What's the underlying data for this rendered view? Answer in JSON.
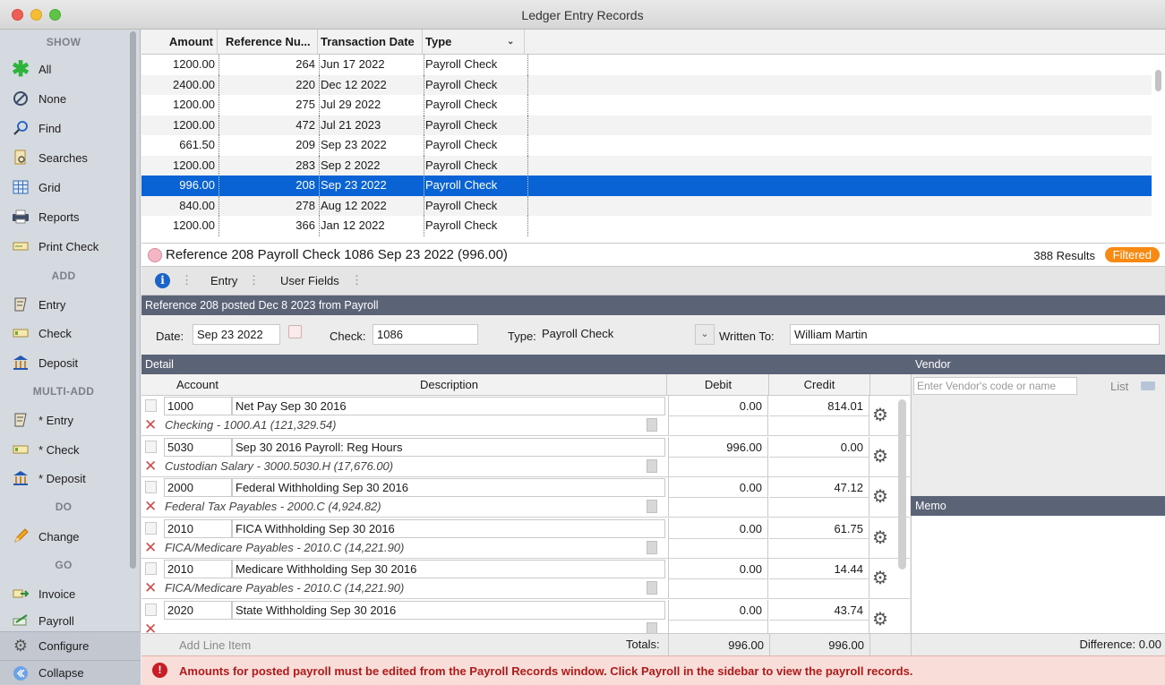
{
  "window": {
    "title": "Ledger Entry Records"
  },
  "sidebar": {
    "sections": {
      "show": "SHOW",
      "add": "ADD",
      "multi_add": "MULTI-ADD",
      "do": "DO",
      "go": "GO"
    },
    "show_items": [
      {
        "label": "All",
        "icon": "asterisk-icon"
      },
      {
        "label": "None",
        "icon": "no-symbol-icon"
      },
      {
        "label": "Find",
        "icon": "magnifier-icon"
      },
      {
        "label": "Searches",
        "icon": "saved-searches-icon"
      },
      {
        "label": "Grid",
        "icon": "grid-icon"
      },
      {
        "label": "Reports",
        "icon": "printer-icon"
      },
      {
        "label": "Print Check",
        "icon": "print-check-icon"
      }
    ],
    "add_items": [
      {
        "label": "Entry",
        "icon": "ledger-icon"
      },
      {
        "label": "Check",
        "icon": "check-icon"
      },
      {
        "label": "Deposit",
        "icon": "bank-icon"
      }
    ],
    "multi_add_items": [
      {
        "label": "* Entry",
        "icon": "ledger-icon"
      },
      {
        "label": "* Check",
        "icon": "check-icon"
      },
      {
        "label": "* Deposit",
        "icon": "bank-icon"
      }
    ],
    "do_items": [
      {
        "label": "Change",
        "icon": "pencil-icon"
      }
    ],
    "go_items": [
      {
        "label": "Invoice",
        "icon": "invoice-icon"
      },
      {
        "label": "Payroll",
        "icon": "payroll-icon"
      }
    ],
    "configure": "Configure",
    "collapse": "Collapse"
  },
  "table": {
    "columns": [
      "Amount",
      "Reference Nu...",
      "Transaction Date",
      "Type"
    ],
    "rows": [
      {
        "amount": "1200.00",
        "ref": "264",
        "date": "Jun 17 2022",
        "type": "Payroll Check"
      },
      {
        "amount": "2400.00",
        "ref": "220",
        "date": "Dec 12 2022",
        "type": "Payroll Check"
      },
      {
        "amount": "1200.00",
        "ref": "275",
        "date": "Jul 29 2022",
        "type": "Payroll Check"
      },
      {
        "amount": "1200.00",
        "ref": "472",
        "date": "Jul 21 2023",
        "type": "Payroll Check"
      },
      {
        "amount": "661.50",
        "ref": "209",
        "date": "Sep 23 2022",
        "type": "Payroll Check"
      },
      {
        "amount": "1200.00",
        "ref": "283",
        "date": "Sep 2 2022",
        "type": "Payroll Check"
      },
      {
        "amount": "996.00",
        "ref": "208",
        "date": "Sep 23 2022",
        "type": "Payroll Check",
        "selected": true
      },
      {
        "amount": "840.00",
        "ref": "278",
        "date": "Aug 12 2022",
        "type": "Payroll Check"
      },
      {
        "amount": "1200.00",
        "ref": "366",
        "date": "Jan 12 2022",
        "type": "Payroll Check"
      }
    ]
  },
  "record": {
    "heading": "Reference 208 Payroll Check 1086 Sep 23 2022 (996.00)",
    "results": "388 Results",
    "filtered": "Filtered",
    "tabs": [
      "Entry",
      "User Fields"
    ],
    "posted_note": "Reference 208 posted Dec 8 2023 from Payroll",
    "date_label": "Date:",
    "date_value": "Sep 23 2022",
    "check_label": "Check:",
    "check_value": "1086",
    "type_label": "Type:",
    "type_value": "Payroll Check",
    "written_to_label": "Written To:",
    "written_to_value": "William Martin"
  },
  "detail": {
    "title": "Detail",
    "headers": {
      "account": "Account",
      "description": "Description",
      "debit": "Debit",
      "credit": "Credit"
    },
    "lines": [
      {
        "account": "1000",
        "description": "Net Pay Sep 30 2016",
        "account_name": "Checking - 1000.A1 (121,329.54)",
        "debit": "0.00",
        "credit": "814.01"
      },
      {
        "account": "5030",
        "description": "Sep 30 2016 Payroll: Reg Hours",
        "account_name": "Custodian Salary - 3000.5030.H (17,676.00)",
        "debit": "996.00",
        "credit": "0.00"
      },
      {
        "account": "2000",
        "description": "Federal Withholding Sep 30 2016",
        "account_name": "Federal Tax Payables - 2000.C (4,924.82)",
        "debit": "0.00",
        "credit": "47.12"
      },
      {
        "account": "2010",
        "description": "FICA Withholding Sep 30 2016",
        "account_name": "FICA/Medicare Payables - 2010.C (14,221.90)",
        "debit": "0.00",
        "credit": "61.75"
      },
      {
        "account": "2010",
        "description": "Medicare Withholding Sep 30 2016",
        "account_name": "FICA/Medicare Payables - 2010.C (14,221.90)",
        "debit": "0.00",
        "credit": "14.44"
      },
      {
        "account": "2020",
        "description": "State Withholding Sep 30 2016",
        "account_name": "",
        "debit": "0.00",
        "credit": "43.74"
      }
    ],
    "add_line": "Add Line Item",
    "totals_label": "Totals:",
    "total_debit": "996.00",
    "total_credit": "996.00",
    "difference": "Difference: 0.00"
  },
  "vendor": {
    "title": "Vendor",
    "placeholder": "Enter Vendor's code or name",
    "list_label": "List",
    "memo_title": "Memo"
  },
  "warning": "Amounts for posted payroll must be edited from the Payroll Records window. Click Payroll in the sidebar to view the payroll records.",
  "colors": {
    "selection": "#0a63d5",
    "section_band": "#5b6377",
    "filtered_badge": "#f78a13",
    "warning_text": "#b11a1a"
  }
}
